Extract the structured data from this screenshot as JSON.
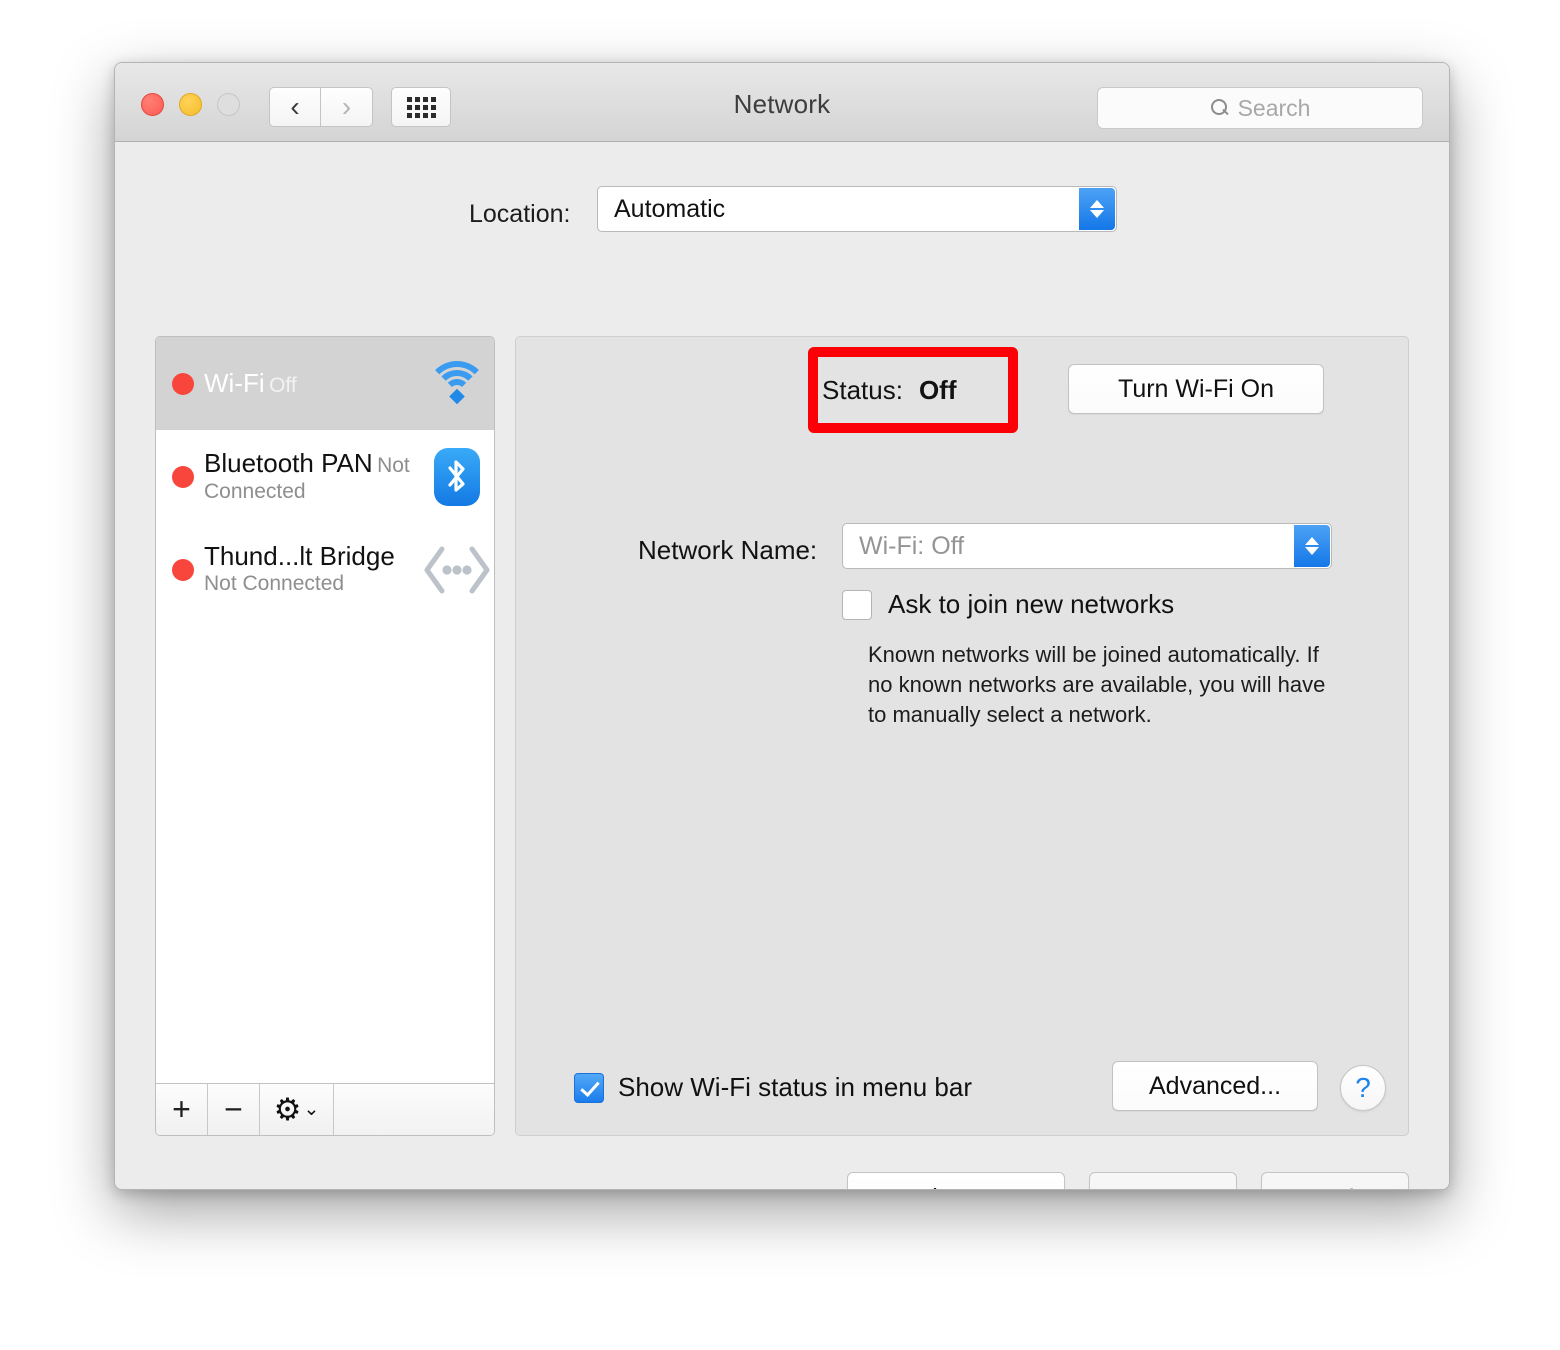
{
  "window": {
    "title": "Network",
    "traffic_lights": [
      "close",
      "minimize",
      "zoom"
    ],
    "search": {
      "placeholder": "Search",
      "value": ""
    }
  },
  "location": {
    "label": "Location:",
    "selected": "Automatic",
    "options": [
      "Automatic"
    ]
  },
  "services": [
    {
      "name": "Wi-Fi",
      "state": "Off",
      "icon": "wifi-icon",
      "selected": true,
      "status_color": "#f9463c"
    },
    {
      "name": "Bluetooth PAN",
      "state": "Not Connected",
      "icon": "bluetooth-icon",
      "selected": false,
      "status_color": "#f9463c"
    },
    {
      "name": "Thund...lt Bridge",
      "state": "Not Connected",
      "icon": "thunderbolt-bridge-icon",
      "selected": false,
      "status_color": "#f9463c"
    }
  ],
  "service_toolbar": {
    "add": "+",
    "remove": "−",
    "gear": "⚙",
    "gear_caret": "⌄"
  },
  "detail": {
    "status_label": "Status:",
    "status_value": "Off",
    "turn_wifi_button": "Turn Wi-Fi On",
    "network_name_label": "Network Name:",
    "network_name_value": "Wi-Fi: Off",
    "ask_to_join_label": "Ask to join new networks",
    "ask_to_join_checked": false,
    "known_networks_description": "Known networks will be joined automatically. If no known networks are available, you will have to manually select a network.",
    "show_status_label": "Show Wi-Fi status in menu bar",
    "show_status_checked": true,
    "advanced_button": "Advanced...",
    "help_button": "?"
  },
  "footer": {
    "assist": "Assist me...",
    "revert": "Revert",
    "apply": "Apply"
  },
  "annotation": {
    "highlight_color": "#fb0007",
    "target": "Status: Off"
  }
}
